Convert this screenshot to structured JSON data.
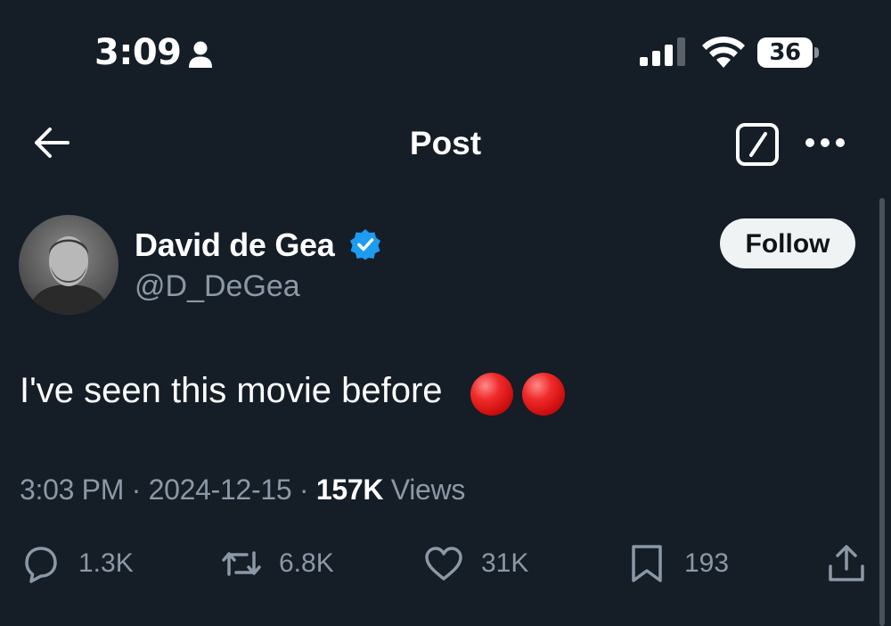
{
  "status_bar": {
    "time": "3:09",
    "battery": "36",
    "icons": [
      "person-icon",
      "signal-icon",
      "wifi-icon",
      "battery-icon"
    ]
  },
  "header": {
    "title": "Post",
    "icons": [
      "back-arrow-icon",
      "edit-icon",
      "more-icon"
    ]
  },
  "post": {
    "author_name": "David de Gea",
    "author_handle": "@D_DeGea",
    "verified": true,
    "follow_label": "Follow",
    "text": "I've seen this movie before",
    "emoji": [
      "red-circle",
      "red-circle"
    ],
    "time": "3:03 PM",
    "separator": "·",
    "date": "2024-12-15",
    "views_count": "157K",
    "views_label": "Views"
  },
  "actions": {
    "replies": "1.3K",
    "reposts": "6.8K",
    "likes": "31K",
    "bookmarks": "193"
  },
  "colors": {
    "background": "#151d27",
    "text_primary": "#ffffff",
    "text_secondary": "#8b98a5",
    "verified_blue": "#1d9bf0",
    "follow_bg": "#eff3f4"
  }
}
